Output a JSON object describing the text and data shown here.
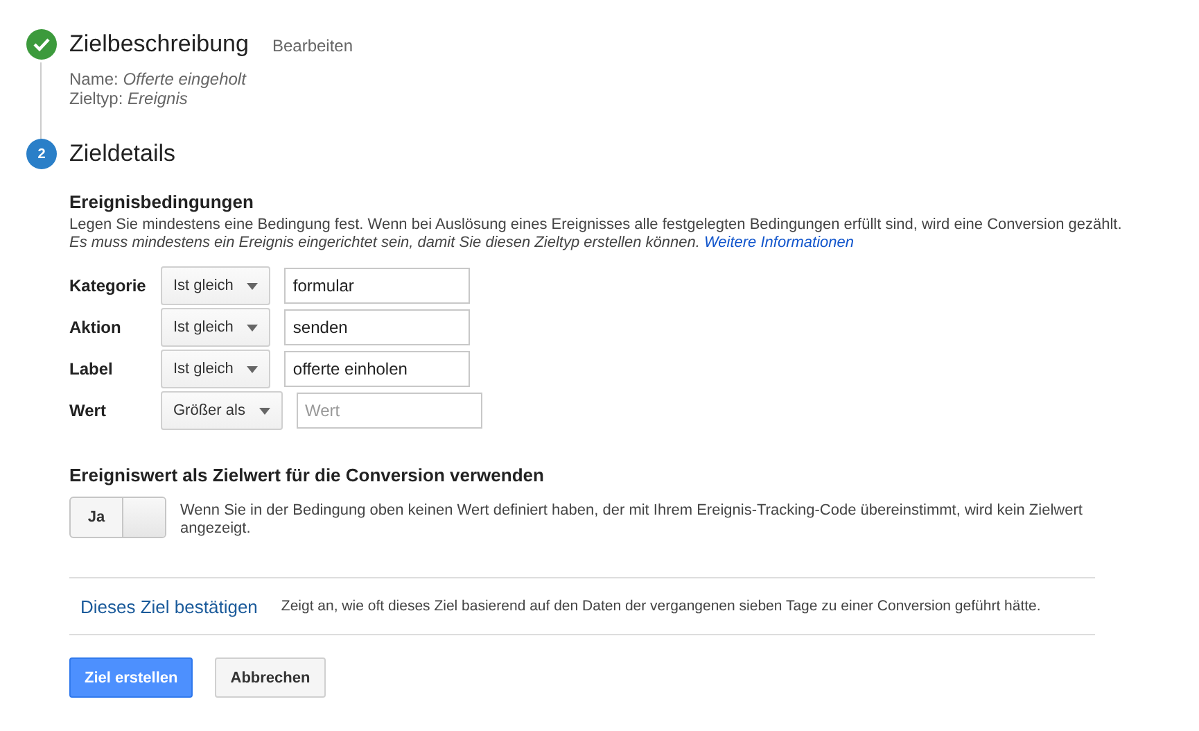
{
  "steps": [
    {
      "kind": "done",
      "title": "Zielbeschreibung",
      "action": "Bearbeiten",
      "fields": [
        {
          "label": "Name:",
          "value": "Offerte eingeholt"
        },
        {
          "label": "Zieltyp:",
          "value": "Ereignis"
        }
      ]
    },
    {
      "kind": "current",
      "number": "2",
      "title": "Zieldetails"
    }
  ],
  "conditions": {
    "title": "Ereignisbedingungen",
    "description": "Legen Sie mindestens eine Bedingung fest. Wenn bei Auslösung eines Ereignisses alle festgelegten Bedingungen erfüllt sind, wird eine Conversion gezählt.",
    "note": "Es muss mindestens ein Ereignis eingerichtet sein, damit Sie diesen Zieltyp erstellen können.",
    "link": "Weitere Informationen",
    "rows": [
      {
        "label": "Kategorie",
        "operator": "Ist gleich",
        "value": "formular"
      },
      {
        "label": "Aktion",
        "operator": "Ist gleich",
        "value": "senden"
      },
      {
        "label": "Label",
        "operator": "Ist gleich",
        "value": "offerte einholen"
      },
      {
        "label": "Wert",
        "operator": "Größer als",
        "placeholder": "Wert"
      }
    ]
  },
  "event_value": {
    "title": "Ereigniswert als Zielwert für die Conversion verwenden",
    "toggle": {
      "label": "Ja",
      "on": true
    },
    "help": "Wenn Sie in der Bedingung oben keinen Wert definiert haben, der mit Ihrem Ereignis-Tracking-Code übereinstimmt, wird kein Zielwert angezeigt."
  },
  "verify": {
    "link": "Dieses Ziel bestätigen",
    "text": "Zeigt an, wie oft dieses Ziel basierend auf den Daten der vergangenen sieben Tage zu einer Conversion geführt hätte."
  },
  "buttons": [
    {
      "label": "Ziel erstellen",
      "kind": "primary"
    },
    {
      "label": "Abbrechen",
      "kind": "secondary"
    }
  ]
}
